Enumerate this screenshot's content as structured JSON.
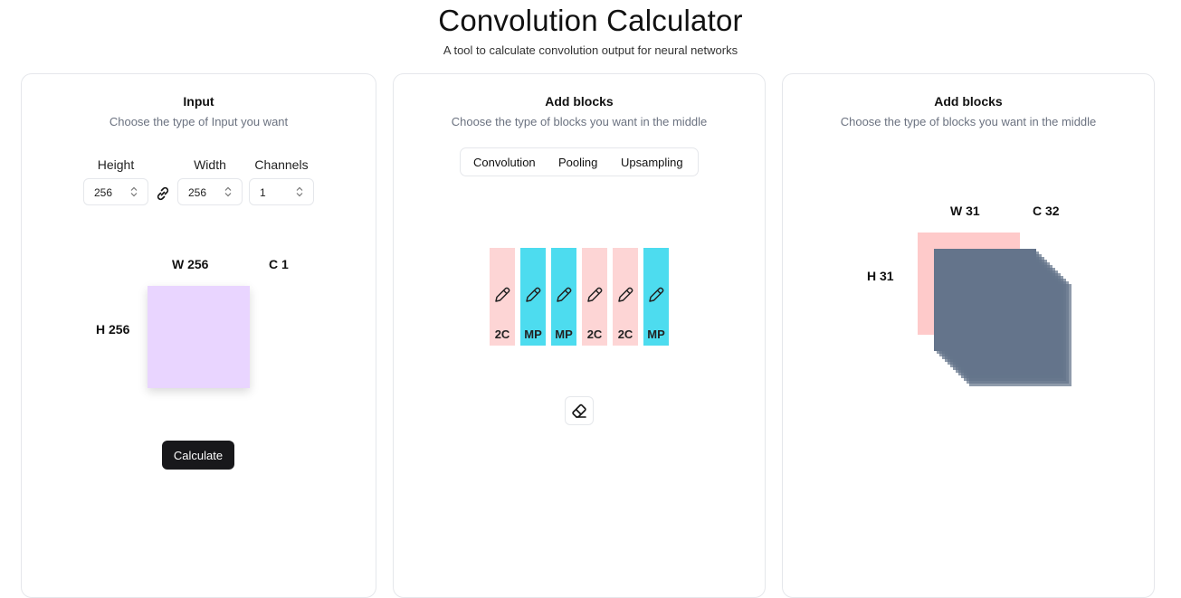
{
  "header": {
    "title": "Convolution Calculator",
    "subtitle": "A tool to calculate convolution output for neural networks"
  },
  "input_card": {
    "title": "Input",
    "description": "Choose the type of Input you want",
    "height_label": "Height",
    "width_label": "Width",
    "channels_label": "Channels",
    "height_value": "256",
    "width_value": "256",
    "channels_value": "1",
    "preview": {
      "width_label": "W 256",
      "height_label": "H 256",
      "channels_label": "C 1",
      "color": "#e9d5ff"
    },
    "calculate_label": "Calculate"
  },
  "blocks_card": {
    "title": "Add blocks",
    "description": "Choose the type of blocks you want in the middle",
    "tabs": [
      "Convolution",
      "Pooling",
      "Upsampling"
    ],
    "blocks": [
      {
        "label": "2C",
        "type": "convolution",
        "color": "#fdd5d5"
      },
      {
        "label": "MP",
        "type": "pooling",
        "color": "#4ddcef"
      },
      {
        "label": "MP",
        "type": "pooling",
        "color": "#4ddcef"
      },
      {
        "label": "2C",
        "type": "convolution",
        "color": "#fdd5d5"
      },
      {
        "label": "2C",
        "type": "convolution",
        "color": "#fdd5d5"
      },
      {
        "label": "MP",
        "type": "pooling",
        "color": "#4ddcef"
      }
    ],
    "edit_icon": "pencil-icon",
    "clear_icon": "eraser-icon"
  },
  "output_card": {
    "title": "Add blocks",
    "description": "Choose the type of blocks you want in the middle",
    "preview": {
      "width_label": "W 31",
      "height_label": "H 31",
      "channels_label": "C 32",
      "front_color": "#fecaca",
      "stack_color": "#64748b"
    }
  }
}
